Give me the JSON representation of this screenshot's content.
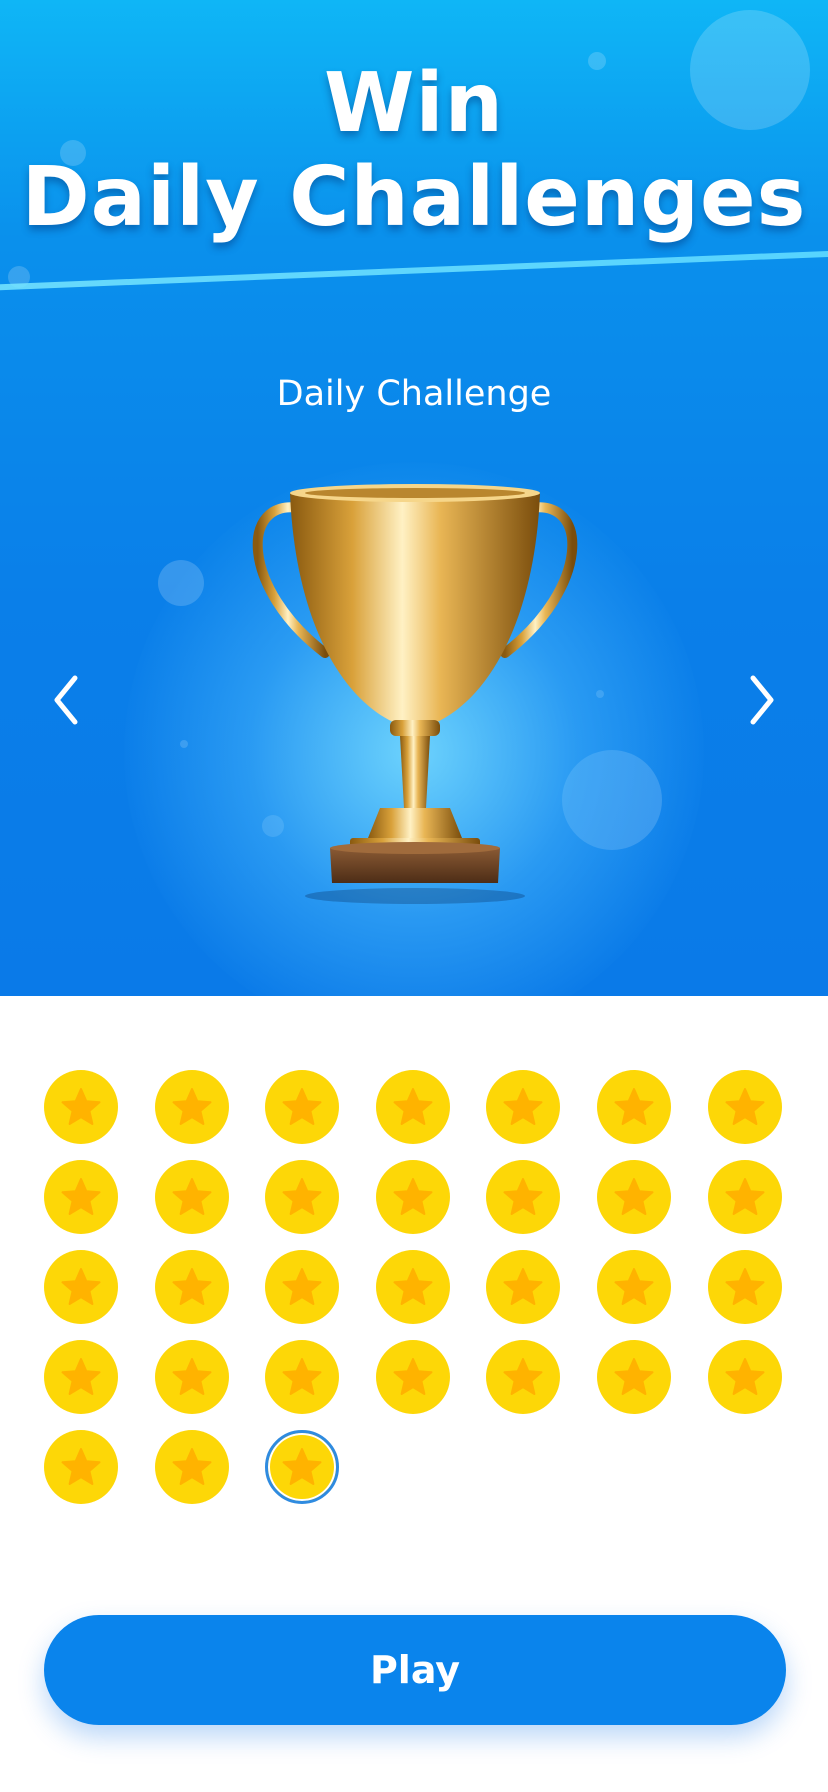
{
  "header": {
    "title_line1": "Win",
    "title_line2": "Daily Challenges"
  },
  "card": {
    "title": "Daily Challenge",
    "image_icon": "trophy-icon",
    "prev_icon": "chevron-left-icon",
    "next_icon": "chevron-right-icon"
  },
  "days": {
    "items": [
      {
        "status": "completed"
      },
      {
        "status": "completed"
      },
      {
        "status": "completed"
      },
      {
        "status": "completed"
      },
      {
        "status": "completed"
      },
      {
        "status": "completed"
      },
      {
        "status": "completed"
      },
      {
        "status": "completed"
      },
      {
        "status": "completed"
      },
      {
        "status": "completed"
      },
      {
        "status": "completed"
      },
      {
        "status": "completed"
      },
      {
        "status": "completed"
      },
      {
        "status": "completed"
      },
      {
        "status": "completed"
      },
      {
        "status": "completed"
      },
      {
        "status": "completed"
      },
      {
        "status": "completed"
      },
      {
        "status": "completed"
      },
      {
        "status": "completed"
      },
      {
        "status": "completed"
      },
      {
        "status": "completed"
      },
      {
        "status": "completed"
      },
      {
        "status": "completed"
      },
      {
        "status": "completed"
      },
      {
        "status": "completed"
      },
      {
        "status": "completed"
      },
      {
        "status": "completed"
      },
      {
        "status": "completed"
      },
      {
        "status": "completed"
      },
      {
        "status": "current"
      }
    ],
    "icon": "star-coin-icon",
    "colors": {
      "coin": "#fdd707",
      "star": "#ffb300",
      "current_ring": "#2f8be0"
    }
  },
  "cta": {
    "play_label": "Play",
    "color": "#0a84ec"
  }
}
